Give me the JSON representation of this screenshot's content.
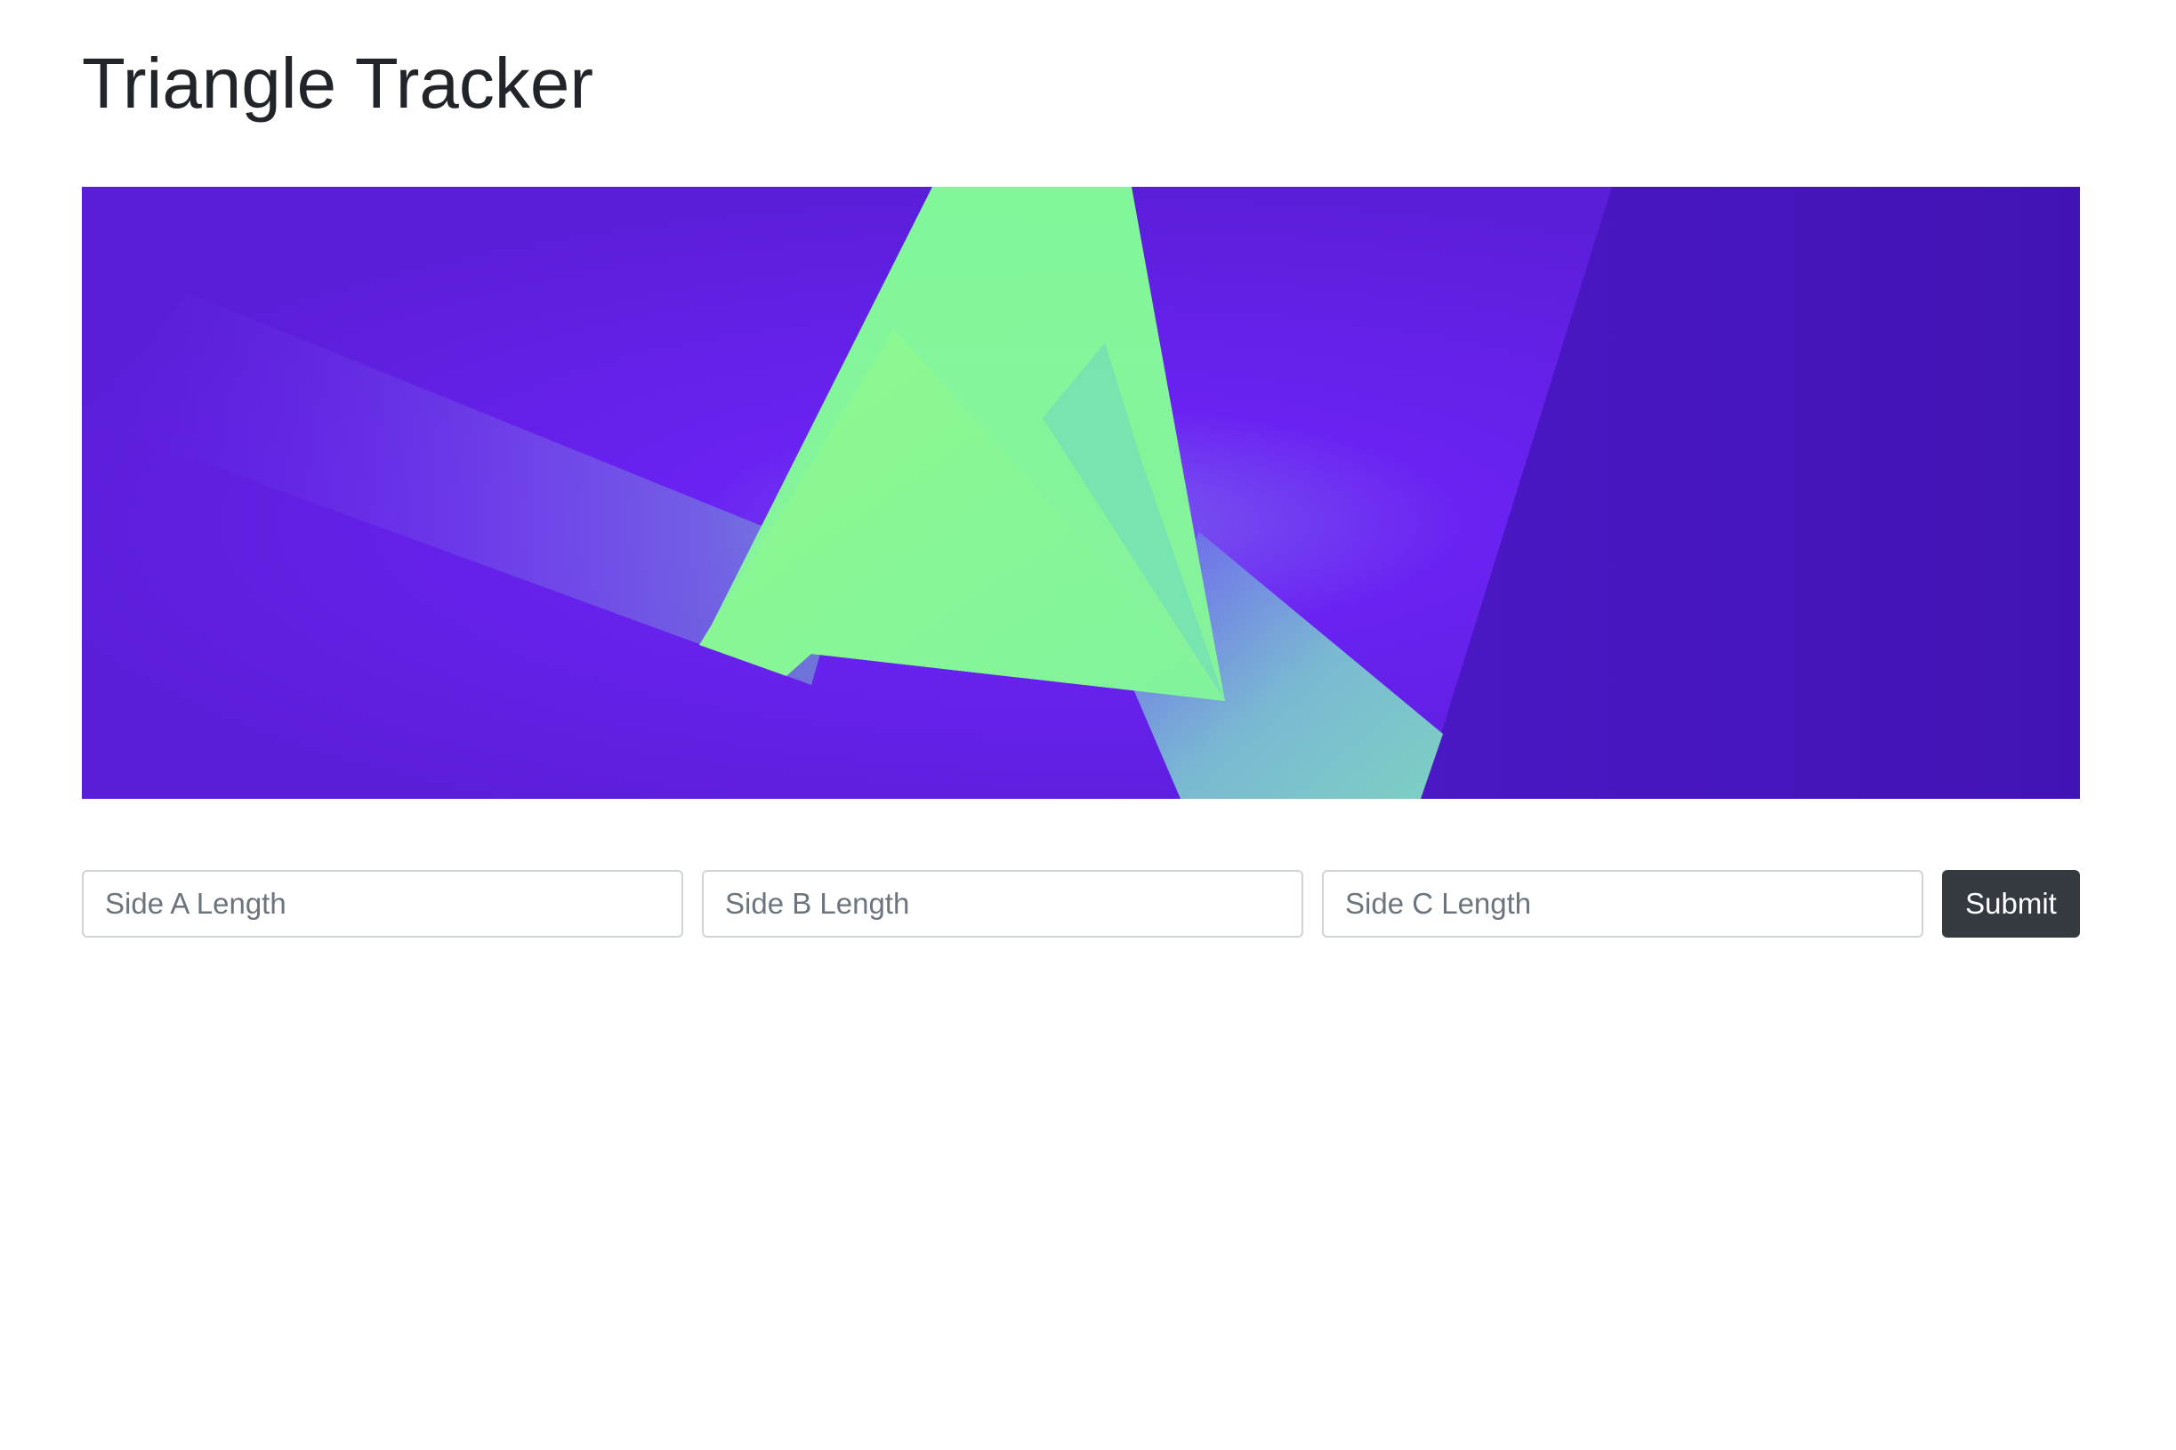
{
  "page": {
    "title": "Triangle Tracker"
  },
  "hero": {
    "image": "abstract-triangles-illustration",
    "colors": {
      "violet": "#6a22f2",
      "deep_violet": "#4415b8",
      "mint": "#82f79a",
      "teal": "#76c6c8"
    }
  },
  "form": {
    "side_a": {
      "placeholder": "Side A Length",
      "value": ""
    },
    "side_b": {
      "placeholder": "Side B Length",
      "value": ""
    },
    "side_c": {
      "placeholder": "Side C Length",
      "value": ""
    },
    "submit_label": "Submit",
    "submit_color": "#343a40"
  }
}
